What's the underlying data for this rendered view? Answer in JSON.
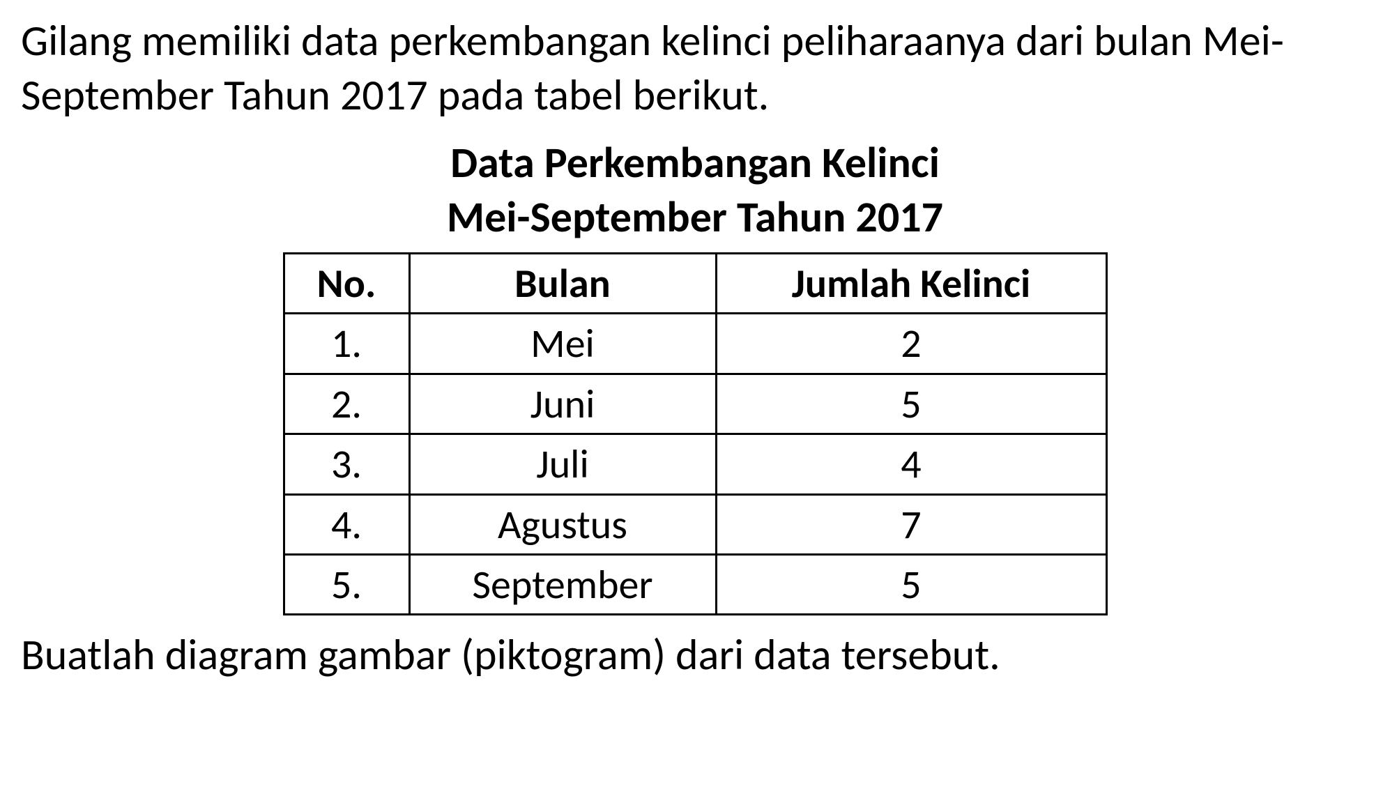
{
  "intro": "Gilang memiliki data perkembangan kelinci peliharaanya dari bulan Mei-September Tahun 2017 pada tabel berikut.",
  "title_line1": "Data Perkembangan Kelinci",
  "title_line2": "Mei-September Tahun 2017",
  "table": {
    "headers": {
      "no": "No.",
      "bulan": "Bulan",
      "jumlah": "Jumlah Kelinci"
    },
    "rows": [
      {
        "no": "1.",
        "bulan": "Mei",
        "jumlah": "2"
      },
      {
        "no": "2.",
        "bulan": "Juni",
        "jumlah": "5"
      },
      {
        "no": "3.",
        "bulan": "Juli",
        "jumlah": "4"
      },
      {
        "no": "4.",
        "bulan": "Agustus",
        "jumlah": "7"
      },
      {
        "no": "5.",
        "bulan": "September",
        "jumlah": "5"
      }
    ]
  },
  "outro": "Buatlah diagram gambar (piktogram) dari data tersebut.",
  "chart_data": {
    "type": "table",
    "title": "Data Perkembangan Kelinci Mei-September Tahun 2017",
    "categories": [
      "Mei",
      "Juni",
      "Juli",
      "Agustus",
      "September"
    ],
    "values": [
      2,
      5,
      4,
      7,
      5
    ],
    "xlabel": "Bulan",
    "ylabel": "Jumlah Kelinci"
  }
}
